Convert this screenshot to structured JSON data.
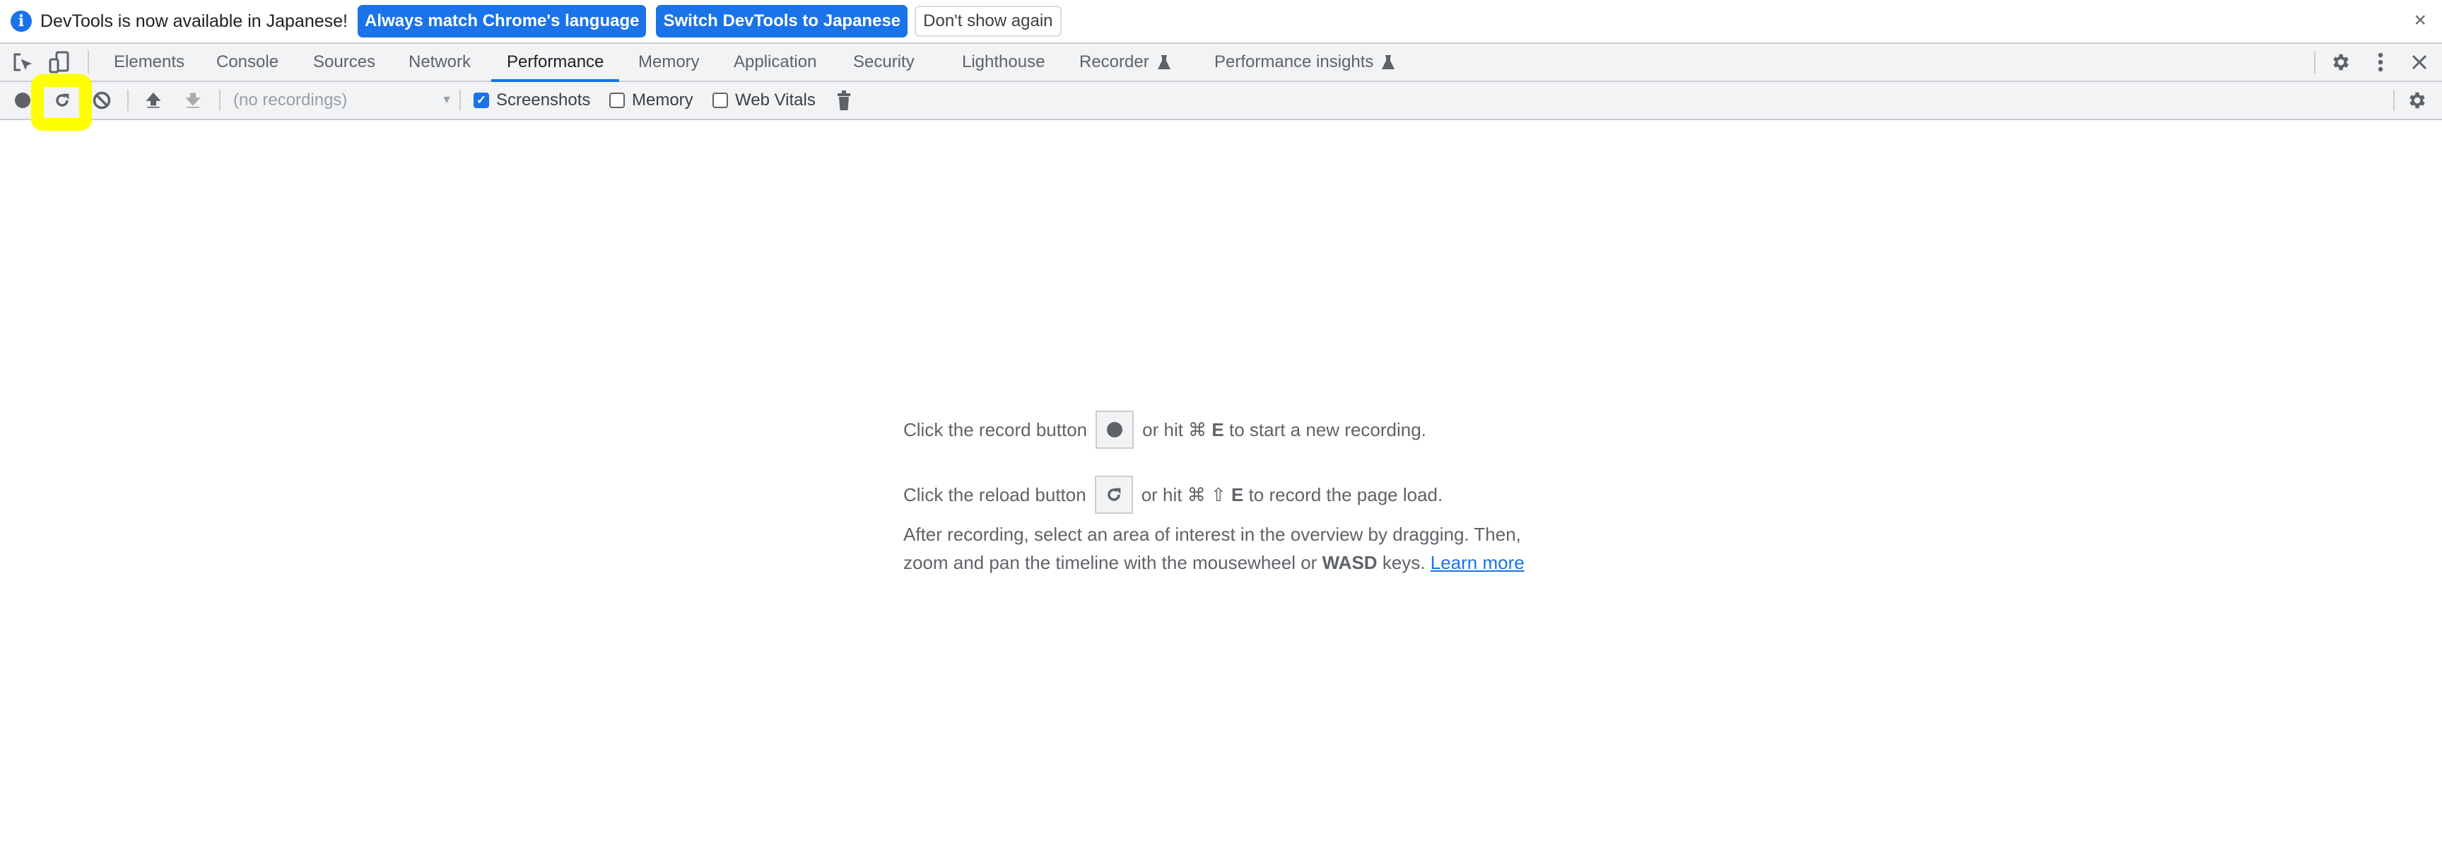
{
  "infobar": {
    "message": "DevTools is now available in Japanese!",
    "buttons": [
      "Always match Chrome's language",
      "Switch DevTools to Japanese",
      "Don't show again"
    ],
    "close": "×"
  },
  "tabs": [
    {
      "label": "Elements"
    },
    {
      "label": "Console"
    },
    {
      "label": "Sources"
    },
    {
      "label": "Network"
    },
    {
      "label": "Performance",
      "active": true
    },
    {
      "label": "Memory"
    },
    {
      "label": "Application"
    },
    {
      "label": "Security"
    },
    {
      "label": "Lighthouse"
    },
    {
      "label": "Recorder",
      "experimental": true
    },
    {
      "label": "Performance insights",
      "experimental": true
    }
  ],
  "toolbar": {
    "recordings_select": "(no recordings)",
    "checkboxes": [
      {
        "label": "Screenshots",
        "checked": true
      },
      {
        "label": "Memory",
        "checked": false
      },
      {
        "label": "Web Vitals",
        "checked": false
      }
    ]
  },
  "landing": {
    "record_pre": "Click the record button",
    "record_post_a": "or hit ⌘",
    "record_key": "E",
    "record_post_b": "to start a new recording.",
    "reload_pre": "Click the reload button",
    "reload_post_a": "or hit ⌘ ⇧",
    "reload_key": "E",
    "reload_post_b": "to record the page load.",
    "after_1": "After recording, select an area of interest in the overview by dragging. Then,",
    "after_2a": "zoom and pan the timeline with the mousewheel or",
    "after_keys": "WASD",
    "after_2b": "keys.",
    "learn_more": "Learn more"
  },
  "colors": {
    "accent": "#1a73e8",
    "highlight": "#ffff00",
    "toolbar_bg": "#f1f3f4"
  }
}
